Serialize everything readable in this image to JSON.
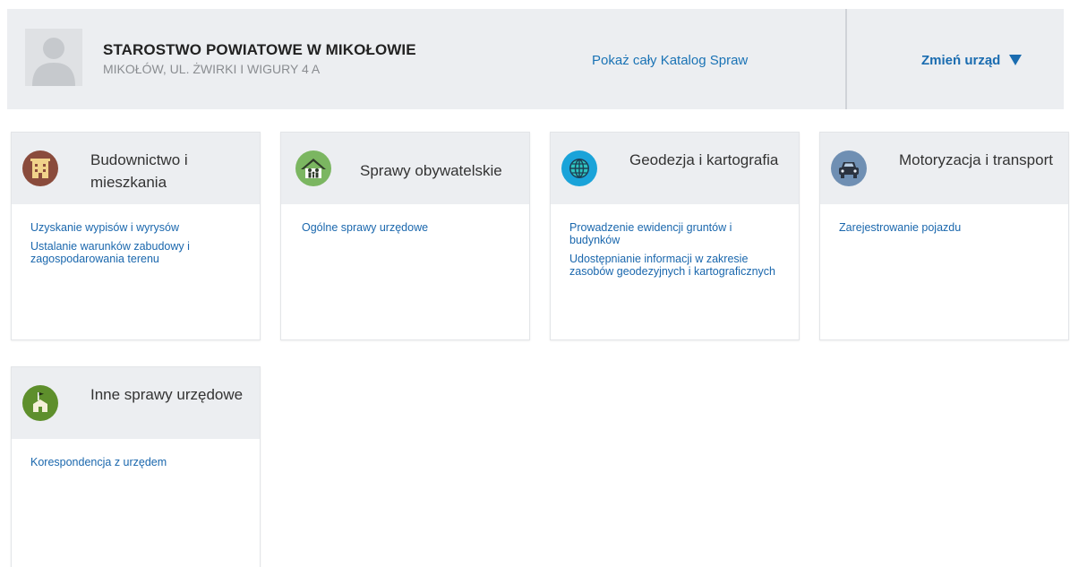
{
  "header": {
    "office_name": "STAROSTWO POWIATOWE W MIKOŁOWIE",
    "office_address": "MIKOŁÓW, UL. ŻWIRKI I WIGURY 4 A",
    "catalog_link": "Pokaż cały Katalog Spraw",
    "change_office": "Zmień urząd"
  },
  "categories": [
    {
      "title": "Budownictwo i mieszkania",
      "icon": "building-icon",
      "icon_color": "#8a4b3c",
      "links": [
        "Uzyskanie wypisów i wyrysów",
        "Ustalanie warunków zabudowy i zagospodarowania terenu"
      ]
    },
    {
      "title": "Sprawy obywatelskie",
      "icon": "family-house-icon",
      "icon_color": "#7bb661",
      "links": [
        "Ogólne sprawy urzędowe"
      ]
    },
    {
      "title": "Geodezja i kartografia",
      "icon": "globe-icon",
      "icon_color": "#1aa3d9",
      "links": [
        "Prowadzenie ewidencji gruntów i budynków",
        "Udostępnianie informacji w zakresie zasobów geodezyjnych i kartograficznych"
      ]
    },
    {
      "title": "Motoryzacja i transport",
      "icon": "car-icon",
      "icon_color": "#6f8fb3",
      "links": [
        "Zarejestrowanie pojazdu"
      ]
    },
    {
      "title": "Inne sprawy urzędowe",
      "icon": "office-flag-icon",
      "icon_color": "#5e8f2c",
      "links": [
        "Korespondencja z urzędem"
      ]
    }
  ]
}
